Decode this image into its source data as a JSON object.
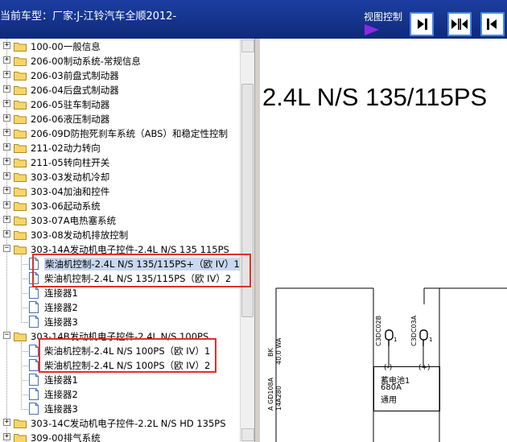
{
  "header": {
    "vehicle_label": "当前车型：厂家:J-江铃汽车全顺2012-",
    "view_control_label": "视图控制",
    "buttons": [
      {
        "name": "show-right-button",
        "icon": "arrow-right-bar-icon"
      },
      {
        "name": "split-view-button",
        "icon": "arrows-split-icon"
      },
      {
        "name": "show-left-button",
        "icon": "arrow-left-bar-icon"
      }
    ]
  },
  "tree": {
    "items": [
      {
        "label": "100-00一般信息",
        "level": 0,
        "type": "folder",
        "expanded": false
      },
      {
        "label": "206-00制动系统-常规信息",
        "level": 0,
        "type": "folder",
        "expanded": false
      },
      {
        "label": "206-03前盘式制动器",
        "level": 0,
        "type": "folder",
        "expanded": false
      },
      {
        "label": "206-04后盘式制动器",
        "level": 0,
        "type": "folder",
        "expanded": false
      },
      {
        "label": "206-05驻车制动器",
        "level": 0,
        "type": "folder",
        "expanded": false
      },
      {
        "label": "206-06液压制动器",
        "level": 0,
        "type": "folder",
        "expanded": false
      },
      {
        "label": "206-09D防抱死刹车系统（ABS）和稳定性控制",
        "level": 0,
        "type": "folder",
        "expanded": false
      },
      {
        "label": "211-02动力转向",
        "level": 0,
        "type": "folder",
        "expanded": false
      },
      {
        "label": "211-05转向柱开关",
        "level": 0,
        "type": "folder",
        "expanded": false
      },
      {
        "label": "303-03发动机冷却",
        "level": 0,
        "type": "folder",
        "expanded": false
      },
      {
        "label": "303-04加油和控件",
        "level": 0,
        "type": "folder",
        "expanded": false
      },
      {
        "label": "303-06起动系统",
        "level": 0,
        "type": "folder",
        "expanded": false
      },
      {
        "label": "303-07A电热塞系统",
        "level": 0,
        "type": "folder",
        "expanded": false
      },
      {
        "label": "303-08发动机排放控制",
        "level": 0,
        "type": "folder",
        "expanded": false
      },
      {
        "label": "303-14A发动机电子控件-2.4L N/S 135 115PS",
        "level": 0,
        "type": "folder",
        "expanded": true
      },
      {
        "label": "柴油机控制-2.4L N/S 135/115PS+（欧 IV）1",
        "level": 1,
        "type": "doc",
        "selected": true
      },
      {
        "label": "柴油机控制-2.4L N/S 135/115PS（欧 IV）2",
        "level": 1,
        "type": "doc"
      },
      {
        "label": "连接器1",
        "level": 1,
        "type": "doc"
      },
      {
        "label": "连接器2",
        "level": 1,
        "type": "doc"
      },
      {
        "label": "连接器3",
        "level": 1,
        "type": "doc"
      },
      {
        "label": "303-14B发动机电子控件-2.4L N/S 100PS",
        "level": 0,
        "type": "folder",
        "expanded": true
      },
      {
        "label": "柴油机控制-2.4L N/S 100PS（欧 IV）1",
        "level": 1,
        "type": "doc"
      },
      {
        "label": "柴油机控制-2.4L N/S 100PS（欧 IV）2",
        "level": 1,
        "type": "doc"
      },
      {
        "label": "连接器1",
        "level": 1,
        "type": "doc"
      },
      {
        "label": "连接器2",
        "level": 1,
        "type": "doc"
      },
      {
        "label": "连接器3",
        "level": 1,
        "type": "doc"
      },
      {
        "label": "303-14C发动机电子控件-2.2L N/S HD 135PS",
        "level": 0,
        "type": "folder",
        "expanded": false
      },
      {
        "label": "309-00排气系统",
        "level": 0,
        "type": "folder",
        "expanded": false
      }
    ]
  },
  "diagram": {
    "title": "2.4L N/S 135/115PS",
    "wire_left": {
      "label_1": "40.0  WA",
      "label_2": "BK",
      "label_3": "A  GD108A",
      "label_4": "14A280"
    },
    "connector_left": "C3DC02B",
    "connector_right": "C3DC03A",
    "pin_left": "1",
    "pin_right": "1",
    "battery": {
      "minus": "(-)",
      "plus": "(+)",
      "name": "蓄电池1",
      "rating": "680A",
      "note": "通用"
    }
  },
  "colors": {
    "header_bg": "#1b3ea0",
    "highlight": "#e0302a",
    "selection": "#c8d8f0",
    "view_arrow": "#8a2be2"
  }
}
